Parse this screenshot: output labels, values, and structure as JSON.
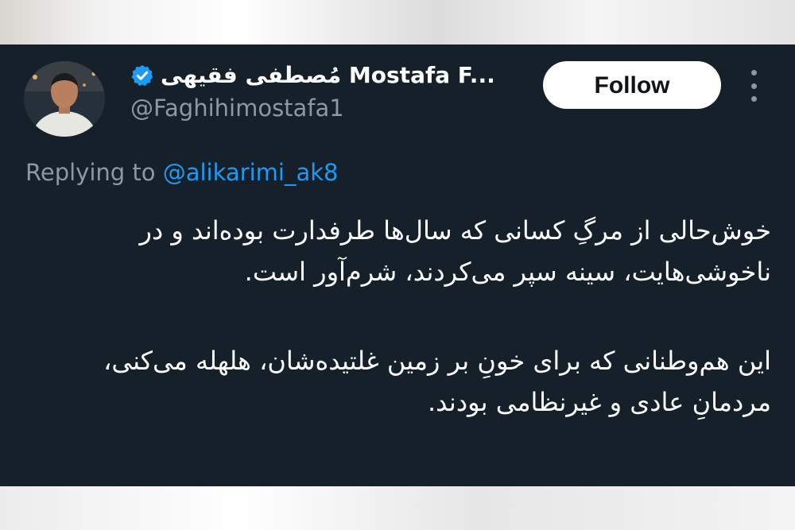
{
  "author": {
    "display_name": "مُصطفی فقیهی Mostafa F...",
    "handle": "@Faghihimostafa1",
    "verified": true,
    "avatar_icon": "user-photo-avatar"
  },
  "actions": {
    "follow_label": "Follow",
    "more_icon": "vertical-dots-icon"
  },
  "reply": {
    "prefix": "Replying to",
    "to_handle": "@alikarimi_ak8"
  },
  "tweet": {
    "paragraphs": [
      "خوش‌حالی از مرگِ کسانی که سال‌ها طرفدارت بوده‌اند و در ناخوشی‌هایت، سینه سپر می‌کردند، شرم‌آور است.",
      "این هم‌وطنانی که برای خونِ بر زمین غلتیده‌شان، هلهله می‌کنی، مردمانِ عادی و غیرنظامی بودند."
    ]
  },
  "colors": {
    "card_background": "#15202b",
    "primary_text": "#ffffff",
    "secondary_text": "#8b98a5",
    "link": "#1d9bf0",
    "follow_button_bg": "#ffffff",
    "verified_badge": "#1d9bf0"
  }
}
